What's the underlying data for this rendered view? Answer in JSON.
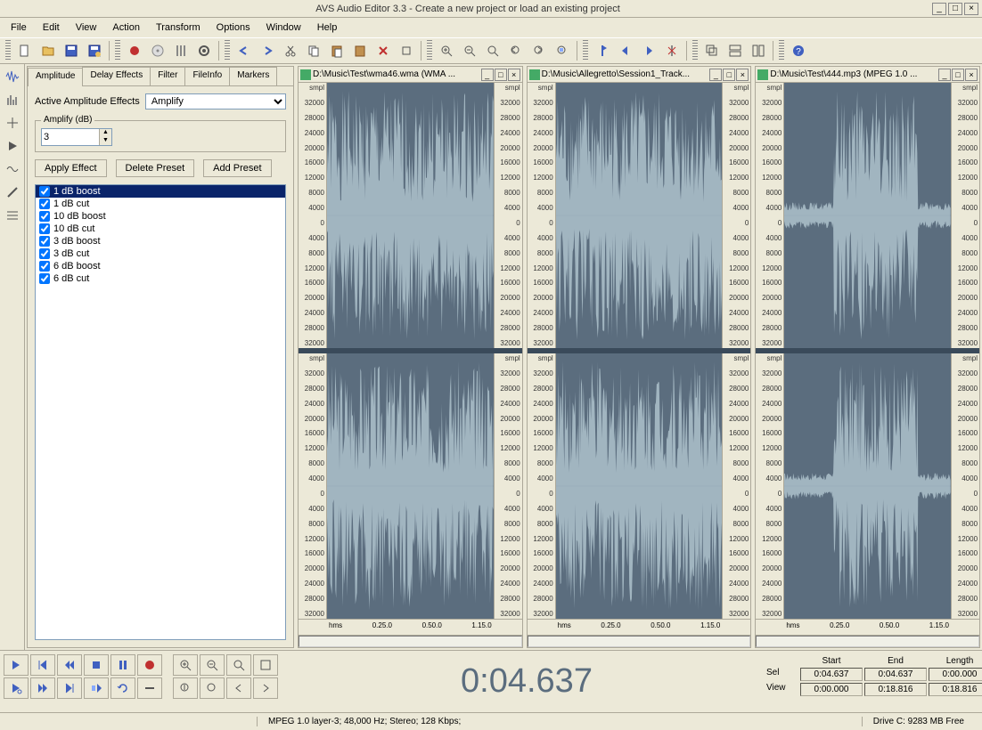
{
  "window": {
    "title": "AVS Audio Editor 3.3 - Create a new project or load an existing project"
  },
  "menu": [
    "File",
    "Edit",
    "View",
    "Action",
    "Transform",
    "Options",
    "Window",
    "Help"
  ],
  "panel": {
    "tabs": [
      "Amplitude",
      "Delay Effects",
      "Filter",
      "FileInfo",
      "Markers"
    ],
    "active_tab": "Amplitude",
    "effect_label": "Active Amplitude Effects",
    "effect_select": "Amplify",
    "amplify_label": "Amplify (dB)",
    "amplify_value": "3",
    "buttons": {
      "apply": "Apply Effect",
      "delete": "Delete Preset",
      "add": "Add Preset"
    },
    "presets": [
      "1 dB boost",
      "1 dB cut",
      "10 dB boost",
      "10 dB cut",
      "3 dB boost",
      "3 dB cut",
      "6 dB boost",
      "6 dB cut"
    ],
    "preset_selected": 0
  },
  "waveforms": [
    {
      "title": "D:\\Music\\Test\\wma46.wma (WMA ..."
    },
    {
      "title": "D:\\Music\\Allegretto\\Session1_Track..."
    },
    {
      "title": "D:\\Music\\Test\\444.mp3 (MPEG 1.0 ..."
    }
  ],
  "amp_ticks": [
    "smpl",
    "32000",
    "28000",
    "24000",
    "20000",
    "16000",
    "12000",
    "8000",
    "4000",
    "0",
    "4000",
    "8000",
    "12000",
    "16000",
    "20000",
    "24000",
    "28000",
    "32000"
  ],
  "time_ticks": [
    "hms",
    "0.25.0",
    "0.50.0",
    "1.15.0"
  ],
  "counter": "0:04.637",
  "selection": {
    "headers": [
      "Start",
      "End",
      "Length"
    ],
    "rows": [
      {
        "label": "Sel",
        "start": "0:04.637",
        "end": "0:04.637",
        "length": "0:00.000"
      },
      {
        "label": "View",
        "start": "0:00.000",
        "end": "0:18.816",
        "length": "0:18.816"
      }
    ]
  },
  "status": {
    "format": "MPEG 1.0 layer-3; 48,000 Hz; Stereo; 128 Kbps;",
    "drive": "Drive C: 9283 MB Free"
  }
}
